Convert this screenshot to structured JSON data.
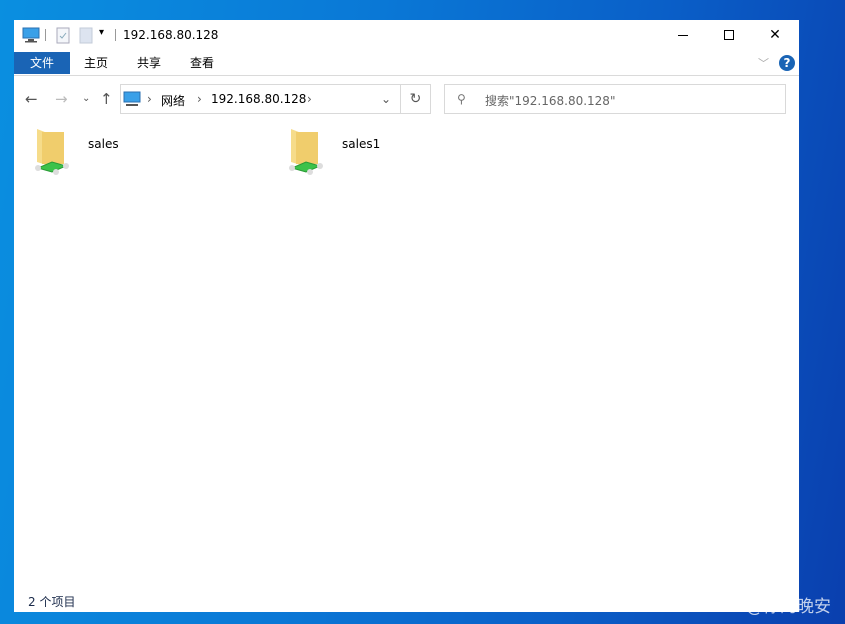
{
  "window": {
    "title": "192.168.80.128"
  },
  "ribbon": {
    "tabs": [
      "文件",
      "主页",
      "共享",
      "查看"
    ]
  },
  "address": {
    "segments": [
      "网络",
      "192.168.80.128"
    ]
  },
  "search": {
    "placeholder": "搜索\"192.168.80.128\""
  },
  "items": [
    {
      "name": "sales"
    },
    {
      "name": "sales1"
    }
  ],
  "status": {
    "count": "2 个项目"
  },
  "watermark": "CSDN @你的晚安",
  "colors": {
    "accent": "#1a64b5",
    "help": "#1a64b5"
  }
}
